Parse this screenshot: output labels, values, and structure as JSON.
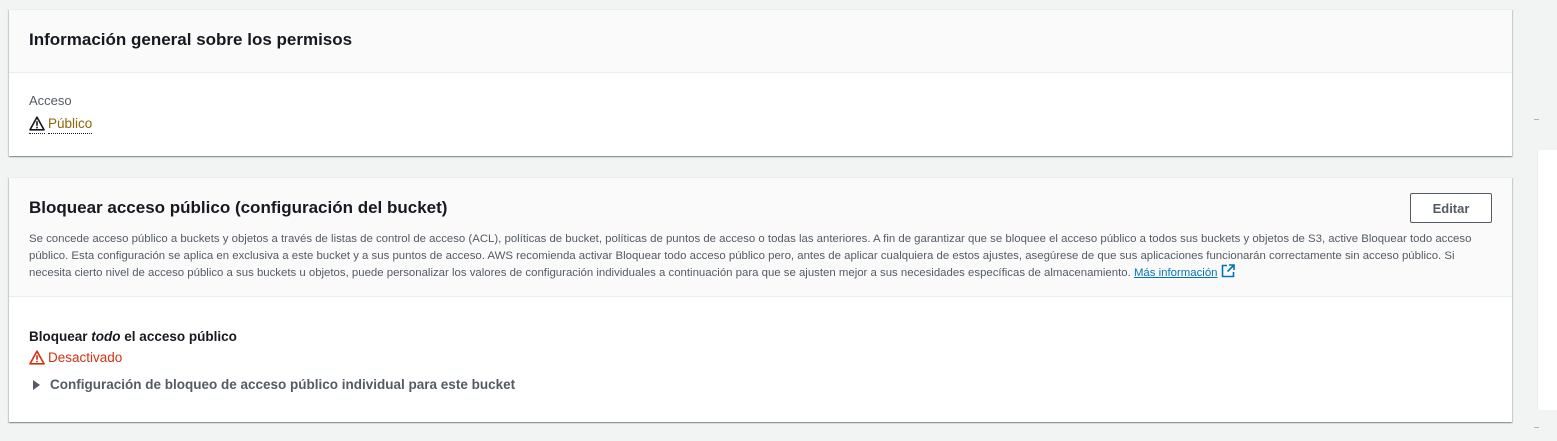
{
  "permissions_overview": {
    "title": "Información general sobre los permisos",
    "access_label": "Acceso",
    "access_value": "Público",
    "access_status_color": "#8d6605"
  },
  "block_public_access": {
    "title": "Bloquear acceso público (configuración del bucket)",
    "edit_label": "Editar",
    "description": "Se concede acceso público a buckets y objetos a través de listas de control de acceso (ACL), políticas de bucket, políticas de puntos de acceso o todas las anteriores. A fin de garantizar que se bloquee el acceso público a todos sus buckets y objetos de S3, active Bloquear todo acceso público. Esta configuración se aplica en exclusiva a este bucket y a sus puntos de acceso. AWS recomienda activar Bloquear todo acceso público pero, antes de aplicar cualquiera de estos ajustes, asegúrese de que sus aplicaciones funcionarán correctamente sin acceso público. Si necesita cierto nivel de acceso público a sus buckets u objetos, puede personalizar los valores de configuración individuales a continuación para que se ajusten mejor a sus necesidades específicas de almacenamiento.",
    "learn_more_label": "Más información",
    "block_all_prefix": "Bloquear",
    "block_all_emphasis": "todo",
    "block_all_suffix": "el acceso público",
    "block_all_status": "Desactivado",
    "block_all_status_color": "#d13212",
    "individual_settings_label": "Configuración de bloqueo de acceso público individual para este bucket"
  },
  "icons": {
    "warning": "warning-icon",
    "external_link": "external-link-icon",
    "caret": "caret-right-icon"
  },
  "colors": {
    "link": "#0073bb",
    "panel_header_bg": "#fafafa",
    "page_bg": "#f2f3f3"
  }
}
